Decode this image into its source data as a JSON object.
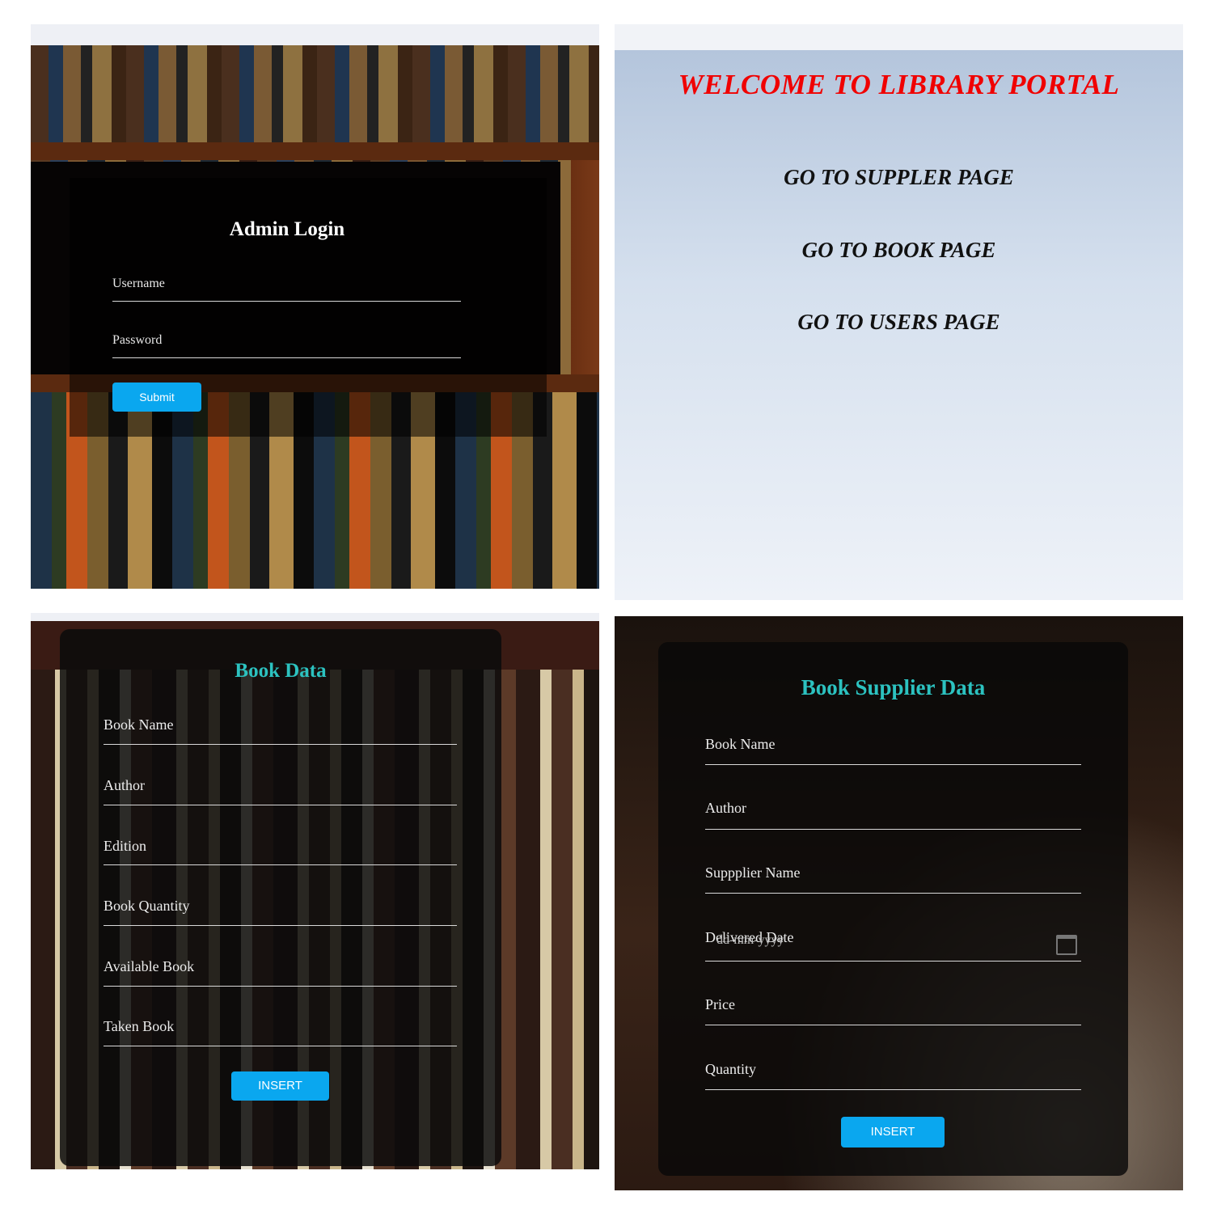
{
  "admin_login": {
    "title": "Admin Login",
    "username_label": "Username",
    "password_label": "Password",
    "submit_label": "Submit"
  },
  "portal": {
    "welcome": "WELCOME TO LIBRARY PORTAL",
    "links": [
      "GO TO SUPPLER PAGE",
      "GO TO BOOK PAGE",
      "GO TO USERS PAGE"
    ]
  },
  "book_data": {
    "title": "Book Data",
    "fields": [
      "Book Name",
      "Author",
      "Edition",
      "Book Quantity",
      "Available Book",
      "Taken Book"
    ],
    "insert_label": "INSERT"
  },
  "supplier_data": {
    "title": "Book Supplier Data",
    "fields": [
      "Book Name",
      "Author",
      "Suppplier Name",
      "Delivered Date",
      "Price",
      "Quantity"
    ],
    "date_placeholder": "dd-mm-yyyy",
    "insert_label": "INSERT"
  },
  "colors": {
    "button": "#0aa7ef",
    "accent_title": "#2cc2c0",
    "welcome_red": "#f00000"
  }
}
